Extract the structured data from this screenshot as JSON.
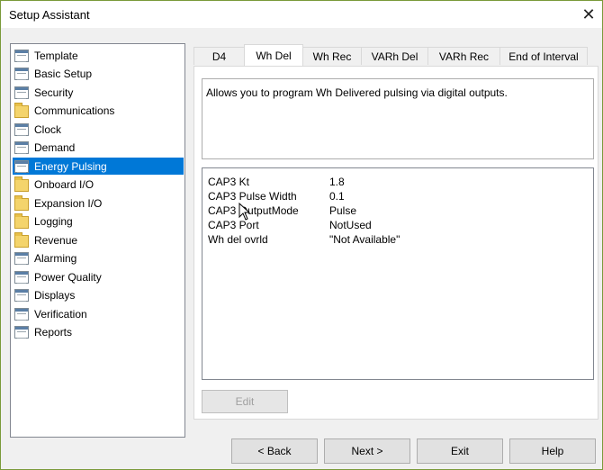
{
  "window": {
    "title": "Setup Assistant",
    "close_glyph": "✕"
  },
  "tree": {
    "items": [
      {
        "label": "Template",
        "icon": "doc-icon"
      },
      {
        "label": "Basic Setup",
        "icon": "doc-icon"
      },
      {
        "label": "Security",
        "icon": "doc-icon"
      },
      {
        "label": "Communications",
        "icon": "folder-icon"
      },
      {
        "label": "Clock",
        "icon": "doc-icon"
      },
      {
        "label": "Demand",
        "icon": "doc-icon"
      },
      {
        "label": "Energy Pulsing",
        "icon": "doc-icon",
        "selected": true
      },
      {
        "label": "Onboard I/O",
        "icon": "folder-icon"
      },
      {
        "label": "Expansion I/O",
        "icon": "folder-icon"
      },
      {
        "label": "Logging",
        "icon": "folder-icon"
      },
      {
        "label": "Revenue",
        "icon": "folder-icon"
      },
      {
        "label": "Alarming",
        "icon": "doc-icon"
      },
      {
        "label": "Power Quality",
        "icon": "doc-icon"
      },
      {
        "label": "Displays",
        "icon": "doc-icon"
      },
      {
        "label": "Verification",
        "icon": "doc-icon"
      },
      {
        "label": "Reports",
        "icon": "doc-icon"
      }
    ]
  },
  "tabs": [
    {
      "label": "D4"
    },
    {
      "label": "Wh Del",
      "active": true
    },
    {
      "label": "Wh Rec"
    },
    {
      "label": "VARh Del"
    },
    {
      "label": "VARh Rec"
    },
    {
      "label": "End of Interval"
    }
  ],
  "description": "Allows you to program Wh Delivered pulsing via digital outputs.",
  "properties": [
    {
      "name": "CAP3 Kt",
      "value": "1.8"
    },
    {
      "name": "CAP3 Pulse Width",
      "value": "0.1"
    },
    {
      "name": "CAP3 OutputMode",
      "value": "Pulse"
    },
    {
      "name": "CAP3 Port",
      "value": "NotUsed"
    },
    {
      "name": "Wh del ovrld",
      "value": "\"Not Available\""
    }
  ],
  "buttons": {
    "edit": "Edit",
    "back": "< Back",
    "next": "Next >",
    "exit": "Exit",
    "help": "Help"
  },
  "colors": {
    "selection": "#0078d7",
    "window_border": "#7a9a3a"
  }
}
